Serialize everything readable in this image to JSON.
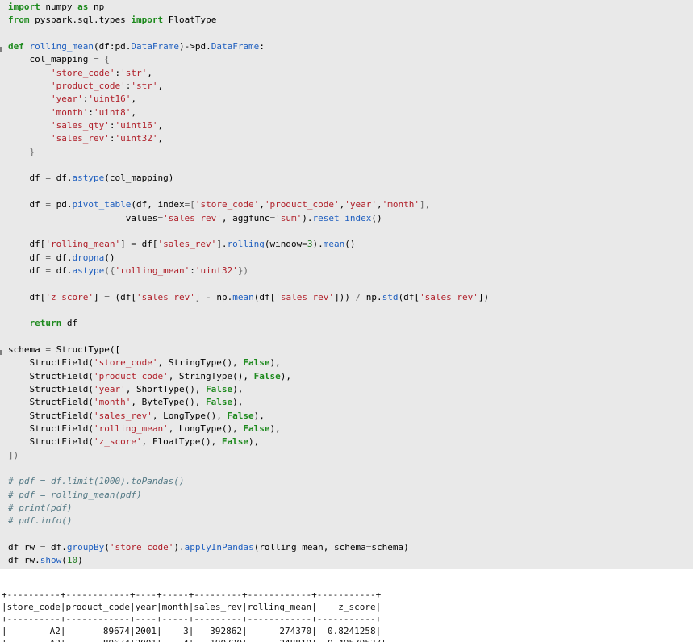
{
  "code_cell": {
    "lines": [
      [
        {
          "t": "import",
          "c": "kw"
        },
        {
          "t": " numpy ",
          "c": "pl"
        },
        {
          "t": "as",
          "c": "kw"
        },
        {
          "t": " np",
          "c": "pl"
        }
      ],
      [
        {
          "t": "from",
          "c": "kw"
        },
        {
          "t": " pyspark.sql.types ",
          "c": "pl"
        },
        {
          "t": "import",
          "c": "kw"
        },
        {
          "t": " FloatType",
          "c": "pl"
        }
      ],
      [],
      [
        {
          "t": "def",
          "c": "kw"
        },
        {
          "t": " ",
          "c": "pl"
        },
        {
          "t": "rolling_mean",
          "c": "fn"
        },
        {
          "t": "(df:pd.",
          "c": "pl"
        },
        {
          "t": "DataFrame",
          "c": "fn"
        },
        {
          "t": ")->pd.",
          "c": "pl"
        },
        {
          "t": "DataFrame",
          "c": "fn"
        },
        {
          "t": ":",
          "c": "pl"
        }
      ],
      [
        {
          "t": "    col_mapping ",
          "c": "pl"
        },
        {
          "t": "=",
          "c": "op"
        },
        {
          "t": " {",
          "c": "op"
        }
      ],
      [
        {
          "t": "        ",
          "c": "pl"
        },
        {
          "t": "'store_code'",
          "c": "str"
        },
        {
          "t": ":",
          "c": "pl"
        },
        {
          "t": "'str'",
          "c": "str"
        },
        {
          "t": ",",
          "c": "pl"
        }
      ],
      [
        {
          "t": "        ",
          "c": "pl"
        },
        {
          "t": "'product_code'",
          "c": "str"
        },
        {
          "t": ":",
          "c": "pl"
        },
        {
          "t": "'str'",
          "c": "str"
        },
        {
          "t": ",",
          "c": "pl"
        }
      ],
      [
        {
          "t": "        ",
          "c": "pl"
        },
        {
          "t": "'year'",
          "c": "str"
        },
        {
          "t": ":",
          "c": "pl"
        },
        {
          "t": "'uint16'",
          "c": "str"
        },
        {
          "t": ",",
          "c": "pl"
        }
      ],
      [
        {
          "t": "        ",
          "c": "pl"
        },
        {
          "t": "'month'",
          "c": "str"
        },
        {
          "t": ":",
          "c": "pl"
        },
        {
          "t": "'uint8'",
          "c": "str"
        },
        {
          "t": ",",
          "c": "pl"
        }
      ],
      [
        {
          "t": "        ",
          "c": "pl"
        },
        {
          "t": "'sales_qty'",
          "c": "str"
        },
        {
          "t": ":",
          "c": "pl"
        },
        {
          "t": "'uint16'",
          "c": "str"
        },
        {
          "t": ",",
          "c": "pl"
        }
      ],
      [
        {
          "t": "        ",
          "c": "pl"
        },
        {
          "t": "'sales_rev'",
          "c": "str"
        },
        {
          "t": ":",
          "c": "pl"
        },
        {
          "t": "'uint32'",
          "c": "str"
        },
        {
          "t": ",",
          "c": "pl"
        }
      ],
      [
        {
          "t": "    }",
          "c": "op"
        }
      ],
      [],
      [
        {
          "t": "    df ",
          "c": "pl"
        },
        {
          "t": "=",
          "c": "op"
        },
        {
          "t": " df.",
          "c": "pl"
        },
        {
          "t": "astype",
          "c": "fn"
        },
        {
          "t": "(col_mapping)",
          "c": "pl"
        }
      ],
      [],
      [
        {
          "t": "    df ",
          "c": "pl"
        },
        {
          "t": "=",
          "c": "op"
        },
        {
          "t": " pd.",
          "c": "pl"
        },
        {
          "t": "pivot_table",
          "c": "fn"
        },
        {
          "t": "(df, index",
          "c": "pl"
        },
        {
          "t": "=[",
          "c": "op"
        },
        {
          "t": "'store_code'",
          "c": "str"
        },
        {
          "t": ",",
          "c": "pl"
        },
        {
          "t": "'product_code'",
          "c": "str"
        },
        {
          "t": ",",
          "c": "pl"
        },
        {
          "t": "'year'",
          "c": "str"
        },
        {
          "t": ",",
          "c": "pl"
        },
        {
          "t": "'month'",
          "c": "str"
        },
        {
          "t": "],",
          "c": "op"
        }
      ],
      [
        {
          "t": "                      values",
          "c": "pl"
        },
        {
          "t": "=",
          "c": "op"
        },
        {
          "t": "'sales_rev'",
          "c": "str"
        },
        {
          "t": ", aggfunc",
          "c": "pl"
        },
        {
          "t": "=",
          "c": "op"
        },
        {
          "t": "'sum'",
          "c": "str"
        },
        {
          "t": ").",
          "c": "pl"
        },
        {
          "t": "reset_index",
          "c": "fn"
        },
        {
          "t": "()",
          "c": "pl"
        }
      ],
      [],
      [
        {
          "t": "    df[",
          "c": "pl"
        },
        {
          "t": "'rolling_mean'",
          "c": "str"
        },
        {
          "t": "] ",
          "c": "pl"
        },
        {
          "t": "=",
          "c": "op"
        },
        {
          "t": " df[",
          "c": "pl"
        },
        {
          "t": "'sales_rev'",
          "c": "str"
        },
        {
          "t": "].",
          "c": "pl"
        },
        {
          "t": "rolling",
          "c": "fn"
        },
        {
          "t": "(window",
          "c": "pl"
        },
        {
          "t": "=",
          "c": "op"
        },
        {
          "t": "3",
          "c": "num"
        },
        {
          "t": ").",
          "c": "pl"
        },
        {
          "t": "mean",
          "c": "fn"
        },
        {
          "t": "()",
          "c": "pl"
        }
      ],
      [
        {
          "t": "    df ",
          "c": "pl"
        },
        {
          "t": "=",
          "c": "op"
        },
        {
          "t": " df.",
          "c": "pl"
        },
        {
          "t": "dropna",
          "c": "fn"
        },
        {
          "t": "()",
          "c": "pl"
        }
      ],
      [
        {
          "t": "    df ",
          "c": "pl"
        },
        {
          "t": "=",
          "c": "op"
        },
        {
          "t": " df.",
          "c": "pl"
        },
        {
          "t": "astype",
          "c": "fn"
        },
        {
          "t": "({",
          "c": "op"
        },
        {
          "t": "'rolling_mean'",
          "c": "str"
        },
        {
          "t": ":",
          "c": "pl"
        },
        {
          "t": "'uint32'",
          "c": "str"
        },
        {
          "t": "})",
          "c": "op"
        }
      ],
      [],
      [
        {
          "t": "    df[",
          "c": "pl"
        },
        {
          "t": "'z_score'",
          "c": "str"
        },
        {
          "t": "] ",
          "c": "pl"
        },
        {
          "t": "=",
          "c": "op"
        },
        {
          "t": " (df[",
          "c": "pl"
        },
        {
          "t": "'sales_rev'",
          "c": "str"
        },
        {
          "t": "] ",
          "c": "pl"
        },
        {
          "t": "-",
          "c": "op"
        },
        {
          "t": " np.",
          "c": "pl"
        },
        {
          "t": "mean",
          "c": "fn"
        },
        {
          "t": "(df[",
          "c": "pl"
        },
        {
          "t": "'sales_rev'",
          "c": "str"
        },
        {
          "t": "])) ",
          "c": "pl"
        },
        {
          "t": "/",
          "c": "op"
        },
        {
          "t": " np.",
          "c": "pl"
        },
        {
          "t": "std",
          "c": "fn"
        },
        {
          "t": "(df[",
          "c": "pl"
        },
        {
          "t": "'sales_rev'",
          "c": "str"
        },
        {
          "t": "])",
          "c": "pl"
        }
      ],
      [],
      [
        {
          "t": "    ",
          "c": "pl"
        },
        {
          "t": "return",
          "c": "kw"
        },
        {
          "t": " df",
          "c": "pl"
        }
      ],
      [],
      [
        {
          "t": "schema ",
          "c": "pl"
        },
        {
          "t": "=",
          "c": "op"
        },
        {
          "t": " StructType([",
          "c": "pl"
        }
      ],
      [
        {
          "t": "    StructField(",
          "c": "pl"
        },
        {
          "t": "'store_code'",
          "c": "str"
        },
        {
          "t": ", StringType(), ",
          "c": "pl"
        },
        {
          "t": "False",
          "c": "bool"
        },
        {
          "t": "),",
          "c": "pl"
        }
      ],
      [
        {
          "t": "    StructField(",
          "c": "pl"
        },
        {
          "t": "'product_code'",
          "c": "str"
        },
        {
          "t": ", StringType(), ",
          "c": "pl"
        },
        {
          "t": "False",
          "c": "bool"
        },
        {
          "t": "),",
          "c": "pl"
        }
      ],
      [
        {
          "t": "    StructField(",
          "c": "pl"
        },
        {
          "t": "'year'",
          "c": "str"
        },
        {
          "t": ", ShortType(), ",
          "c": "pl"
        },
        {
          "t": "False",
          "c": "bool"
        },
        {
          "t": "),",
          "c": "pl"
        }
      ],
      [
        {
          "t": "    StructField(",
          "c": "pl"
        },
        {
          "t": "'month'",
          "c": "str"
        },
        {
          "t": ", ByteType(), ",
          "c": "pl"
        },
        {
          "t": "False",
          "c": "bool"
        },
        {
          "t": "),",
          "c": "pl"
        }
      ],
      [
        {
          "t": "    StructField(",
          "c": "pl"
        },
        {
          "t": "'sales_rev'",
          "c": "str"
        },
        {
          "t": ", LongType(), ",
          "c": "pl"
        },
        {
          "t": "False",
          "c": "bool"
        },
        {
          "t": "),",
          "c": "pl"
        }
      ],
      [
        {
          "t": "    StructField(",
          "c": "pl"
        },
        {
          "t": "'rolling_mean'",
          "c": "str"
        },
        {
          "t": ", LongType(), ",
          "c": "pl"
        },
        {
          "t": "False",
          "c": "bool"
        },
        {
          "t": "),",
          "c": "pl"
        }
      ],
      [
        {
          "t": "    StructField(",
          "c": "pl"
        },
        {
          "t": "'z_score'",
          "c": "str"
        },
        {
          "t": ", FloatType(), ",
          "c": "pl"
        },
        {
          "t": "False",
          "c": "bool"
        },
        {
          "t": "),",
          "c": "pl"
        }
      ],
      [
        {
          "t": "])",
          "c": "op"
        }
      ],
      [],
      [
        {
          "t": "# pdf = df.limit(1000).toPandas()",
          "c": "cm"
        }
      ],
      [
        {
          "t": "# pdf = rolling_mean(pdf)",
          "c": "cm"
        }
      ],
      [
        {
          "t": "# print(pdf)",
          "c": "cm"
        }
      ],
      [
        {
          "t": "# pdf.info()",
          "c": "cm"
        }
      ],
      [],
      [
        {
          "t": "df_rw ",
          "c": "pl"
        },
        {
          "t": "=",
          "c": "op"
        },
        {
          "t": " df.",
          "c": "pl"
        },
        {
          "t": "groupBy",
          "c": "fn"
        },
        {
          "t": "(",
          "c": "pl"
        },
        {
          "t": "'store_code'",
          "c": "str"
        },
        {
          "t": ").",
          "c": "pl"
        },
        {
          "t": "applyInPandas",
          "c": "fn"
        },
        {
          "t": "(rolling_mean, schema",
          "c": "pl"
        },
        {
          "t": "=",
          "c": "op"
        },
        {
          "t": "schema)",
          "c": "pl"
        }
      ],
      [
        {
          "t": "df_rw.",
          "c": "pl"
        },
        {
          "t": "show",
          "c": "fn"
        },
        {
          "t": "(",
          "c": "pl"
        },
        {
          "t": "10",
          "c": "num"
        },
        {
          "t": ")",
          "c": "pl"
        }
      ]
    ]
  },
  "output": {
    "lines": [
      "+----------+------------+----+-----+---------+------------+-----------+",
      "|store_code|product_code|year|month|sales_rev|rolling_mean|    z_score|",
      "+----------+------------+----+-----+---------+------------+-----------+",
      "|        A2|       89674|2001|    3|   392862|      274370|  0.8241258|",
      "|        A2|       89674|2001|    4|   190720|      248819| -0.49579537|"
    ]
  },
  "colors": {
    "code_background": "#e9e9e9",
    "keyword": "#1e8a1e",
    "string": "#b0202a",
    "function": "#1f5fbf",
    "comment": "#557a86",
    "separator": "#2f7fd1"
  }
}
